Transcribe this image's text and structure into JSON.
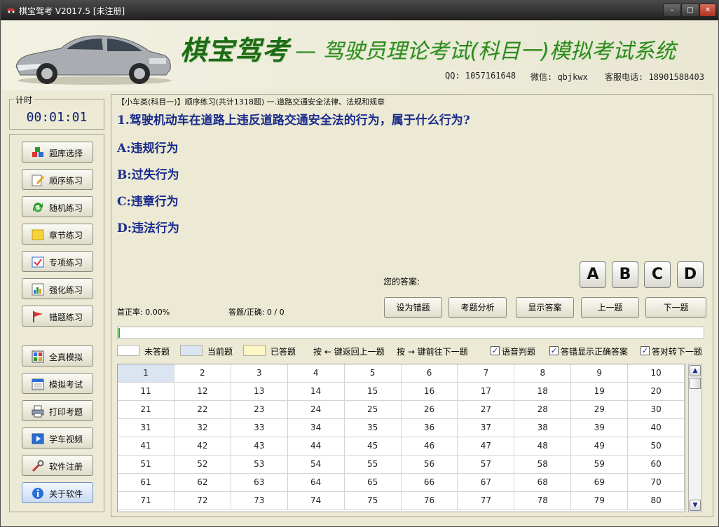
{
  "window": {
    "title": "棋宝驾考 V2017.5 [未注册]",
    "min": "–",
    "max": "□",
    "close": "✕"
  },
  "banner": {
    "brand": "棋宝驾考",
    "subtitle": "— 驾驶员理论考试(科目一)模拟考试系统",
    "qq": "QQ: 1057161648",
    "wechat": "微信: qbjkwx",
    "phone": "客服电话: 18901588403"
  },
  "timer": {
    "label": "计时",
    "value": "00:01:01"
  },
  "menu": [
    {
      "label": "题库选择",
      "icon": "database-icon"
    },
    {
      "label": "顺序练习",
      "icon": "edit-icon"
    },
    {
      "label": "随机练习",
      "icon": "refresh-icon"
    },
    {
      "label": "章节练习",
      "icon": "note-icon"
    },
    {
      "label": "专项练习",
      "icon": "checklist-icon"
    },
    {
      "label": "强化练习",
      "icon": "chart-icon"
    },
    {
      "label": "错题练习",
      "icon": "flag-icon"
    },
    {
      "label": "全真模拟",
      "icon": "calculator-icon"
    },
    {
      "label": "模拟考试",
      "icon": "calendar-icon"
    },
    {
      "label": "打印考题",
      "icon": "printer-icon"
    },
    {
      "label": "学车视频",
      "icon": "video-icon"
    },
    {
      "label": "软件注册",
      "icon": "wrench-icon"
    },
    {
      "label": "关于软件",
      "icon": "info-icon"
    }
  ],
  "main": {
    "breadcrumb": "【小车类(科目一)】顺序练习(共计1318题) 一.道路交通安全法律、法规和规章",
    "question": "1.驾驶机动车在道路上违反道路交通安全法的行为，属于什么行为?",
    "options": [
      "A:违规行为",
      "B:过失行为",
      "C:违章行为",
      "D:违法行为"
    ],
    "your_answer_label": "您的答案:",
    "answer_buttons": [
      "A",
      "B",
      "C",
      "D"
    ],
    "first_correct_rate": "首正率: 0.00%",
    "answered_correct": "答题/正确: 0 / 0",
    "actions": [
      "设为错题",
      "考题分析",
      "显示答案",
      "上一题",
      "下一题"
    ],
    "progress_fraction": 0.002
  },
  "legend": {
    "unanswered": "未答题",
    "current": "当前题",
    "answered": "已答题",
    "prev_hint": "按 ← 键返回上一题",
    "next_hint": "按 → 键前往下一题",
    "voice": "语音判题",
    "show_correct": "答错显示正确答案",
    "auto_next": "答对转下一题"
  },
  "colors": {
    "current": "#dbe5f1",
    "answered": "#fdf5c4",
    "unanswered": "#ffffff",
    "question_text": "#1a2b8c",
    "brand": "#1e6b16"
  },
  "grid_numbers": [
    [
      "1",
      "2",
      "3",
      "4",
      "5",
      "6",
      "7",
      "8",
      "9",
      "10"
    ],
    [
      "11",
      "12",
      "13",
      "14",
      "15",
      "16",
      "17",
      "18",
      "19",
      "20"
    ],
    [
      "21",
      "22",
      "23",
      "24",
      "25",
      "26",
      "27",
      "28",
      "29",
      "30"
    ],
    [
      "31",
      "32",
      "33",
      "34",
      "35",
      "36",
      "37",
      "38",
      "39",
      "40"
    ],
    [
      "41",
      "42",
      "43",
      "44",
      "45",
      "46",
      "47",
      "48",
      "49",
      "50"
    ],
    [
      "51",
      "52",
      "53",
      "54",
      "55",
      "56",
      "57",
      "58",
      "59",
      "60"
    ],
    [
      "61",
      "62",
      "63",
      "64",
      "65",
      "66",
      "67",
      "68",
      "69",
      "70"
    ],
    [
      "71",
      "72",
      "73",
      "74",
      "75",
      "76",
      "77",
      "78",
      "79",
      "80"
    ]
  ]
}
